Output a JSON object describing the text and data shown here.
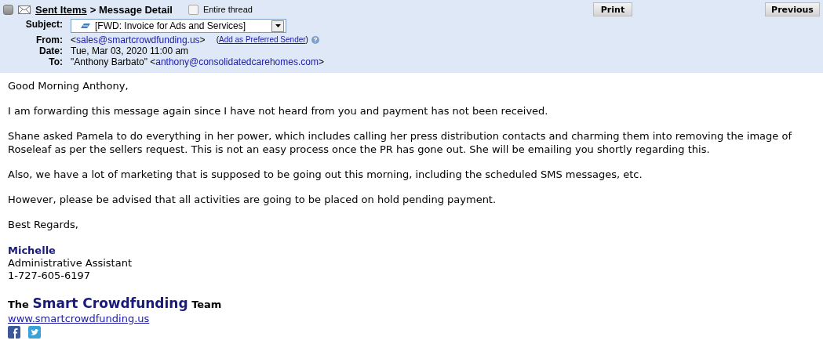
{
  "header": {
    "breadcrumb_link": "Sent Items",
    "breadcrumb_current": "> Message Detail",
    "entire_thread": {
      "label": "Entire thread",
      "checked": false
    },
    "print_button": "Print",
    "previous_button": "Previous",
    "fields": [
      {
        "kind": "select",
        "label": "Subject:",
        "value": "[FWD: Invoice for Ads and Services]"
      },
      {
        "kind": "sender",
        "label": "From:",
        "open": "<",
        "email": "sales@smartcrowdfunding.us",
        "close": ">",
        "action_open": "(",
        "action": "Add as Preferred Sender",
        "action_close": ")"
      },
      {
        "kind": "text",
        "label": "Date:",
        "value": "Tue, Mar 03, 2020 11:00 am"
      },
      {
        "kind": "recipient",
        "label": "To:",
        "name": "\"Anthony Barbato\"",
        "open": "<",
        "email": "anthony@consolidatedcarehomes.com",
        "close": ">"
      }
    ]
  },
  "body": {
    "paragraphs": [
      "Good Morning Anthony,",
      "I am forwarding this message again since I have not heard from you and payment has not been received.",
      "Shane asked Pamela to do everything in her power, which includes calling her press distribution contacts and charming them into removing the image of Roseleaf as per the sellers request. This is not an easy process once the PR has gone out. She will be emailing you shortly regarding this.",
      "Also, we have a lot of marketing that is supposed to be going out this morning, including the scheduled SMS messages, etc.",
      "However, please be advised that all activities are going to be placed on hold pending payment.",
      "Best Regards,"
    ],
    "signature": {
      "name": "Michelle",
      "title": "Administrative Assistant",
      "phone": "1-727-605-6197",
      "team_prefix": "The",
      "team_brand": "Smart Crowdfunding",
      "team_suffix": "Team",
      "website": "www.smartcrowdfunding.us"
    }
  }
}
